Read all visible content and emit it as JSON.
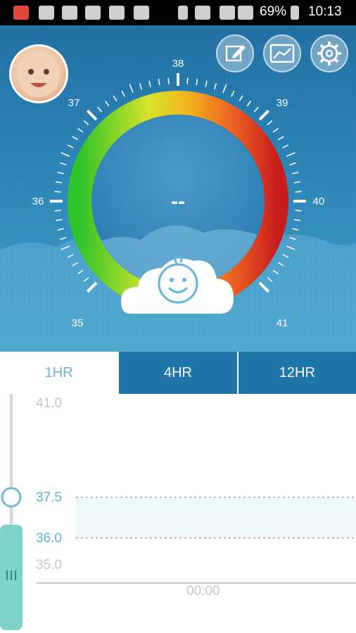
{
  "status_bar": {
    "battery": "69%",
    "time": "10:13"
  },
  "gauge": {
    "tick_labels": [
      "35",
      "36",
      "37",
      "38",
      "39",
      "40",
      "41"
    ],
    "reading": "--"
  },
  "toolbar": {
    "edit_icon": "edit-icon",
    "chart_icon": "chart-icon",
    "settings_icon": "gear-icon"
  },
  "tabs": [
    {
      "label": "1HR",
      "active": true
    },
    {
      "label": "4HR",
      "active": false
    },
    {
      "label": "12HR",
      "active": false
    }
  ],
  "chart_data": {
    "type": "line",
    "y_ticks": [
      "41.0",
      "37.5",
      "36.0",
      "35.0"
    ],
    "x_ticks": [
      "00:00"
    ],
    "normal_band": [
      36.0,
      37.5
    ],
    "series": []
  },
  "colors": {
    "primary": "#1f74a8",
    "accent": "#5db5d6",
    "band": "#eefaf9",
    "handle": "#7fd3c9"
  }
}
